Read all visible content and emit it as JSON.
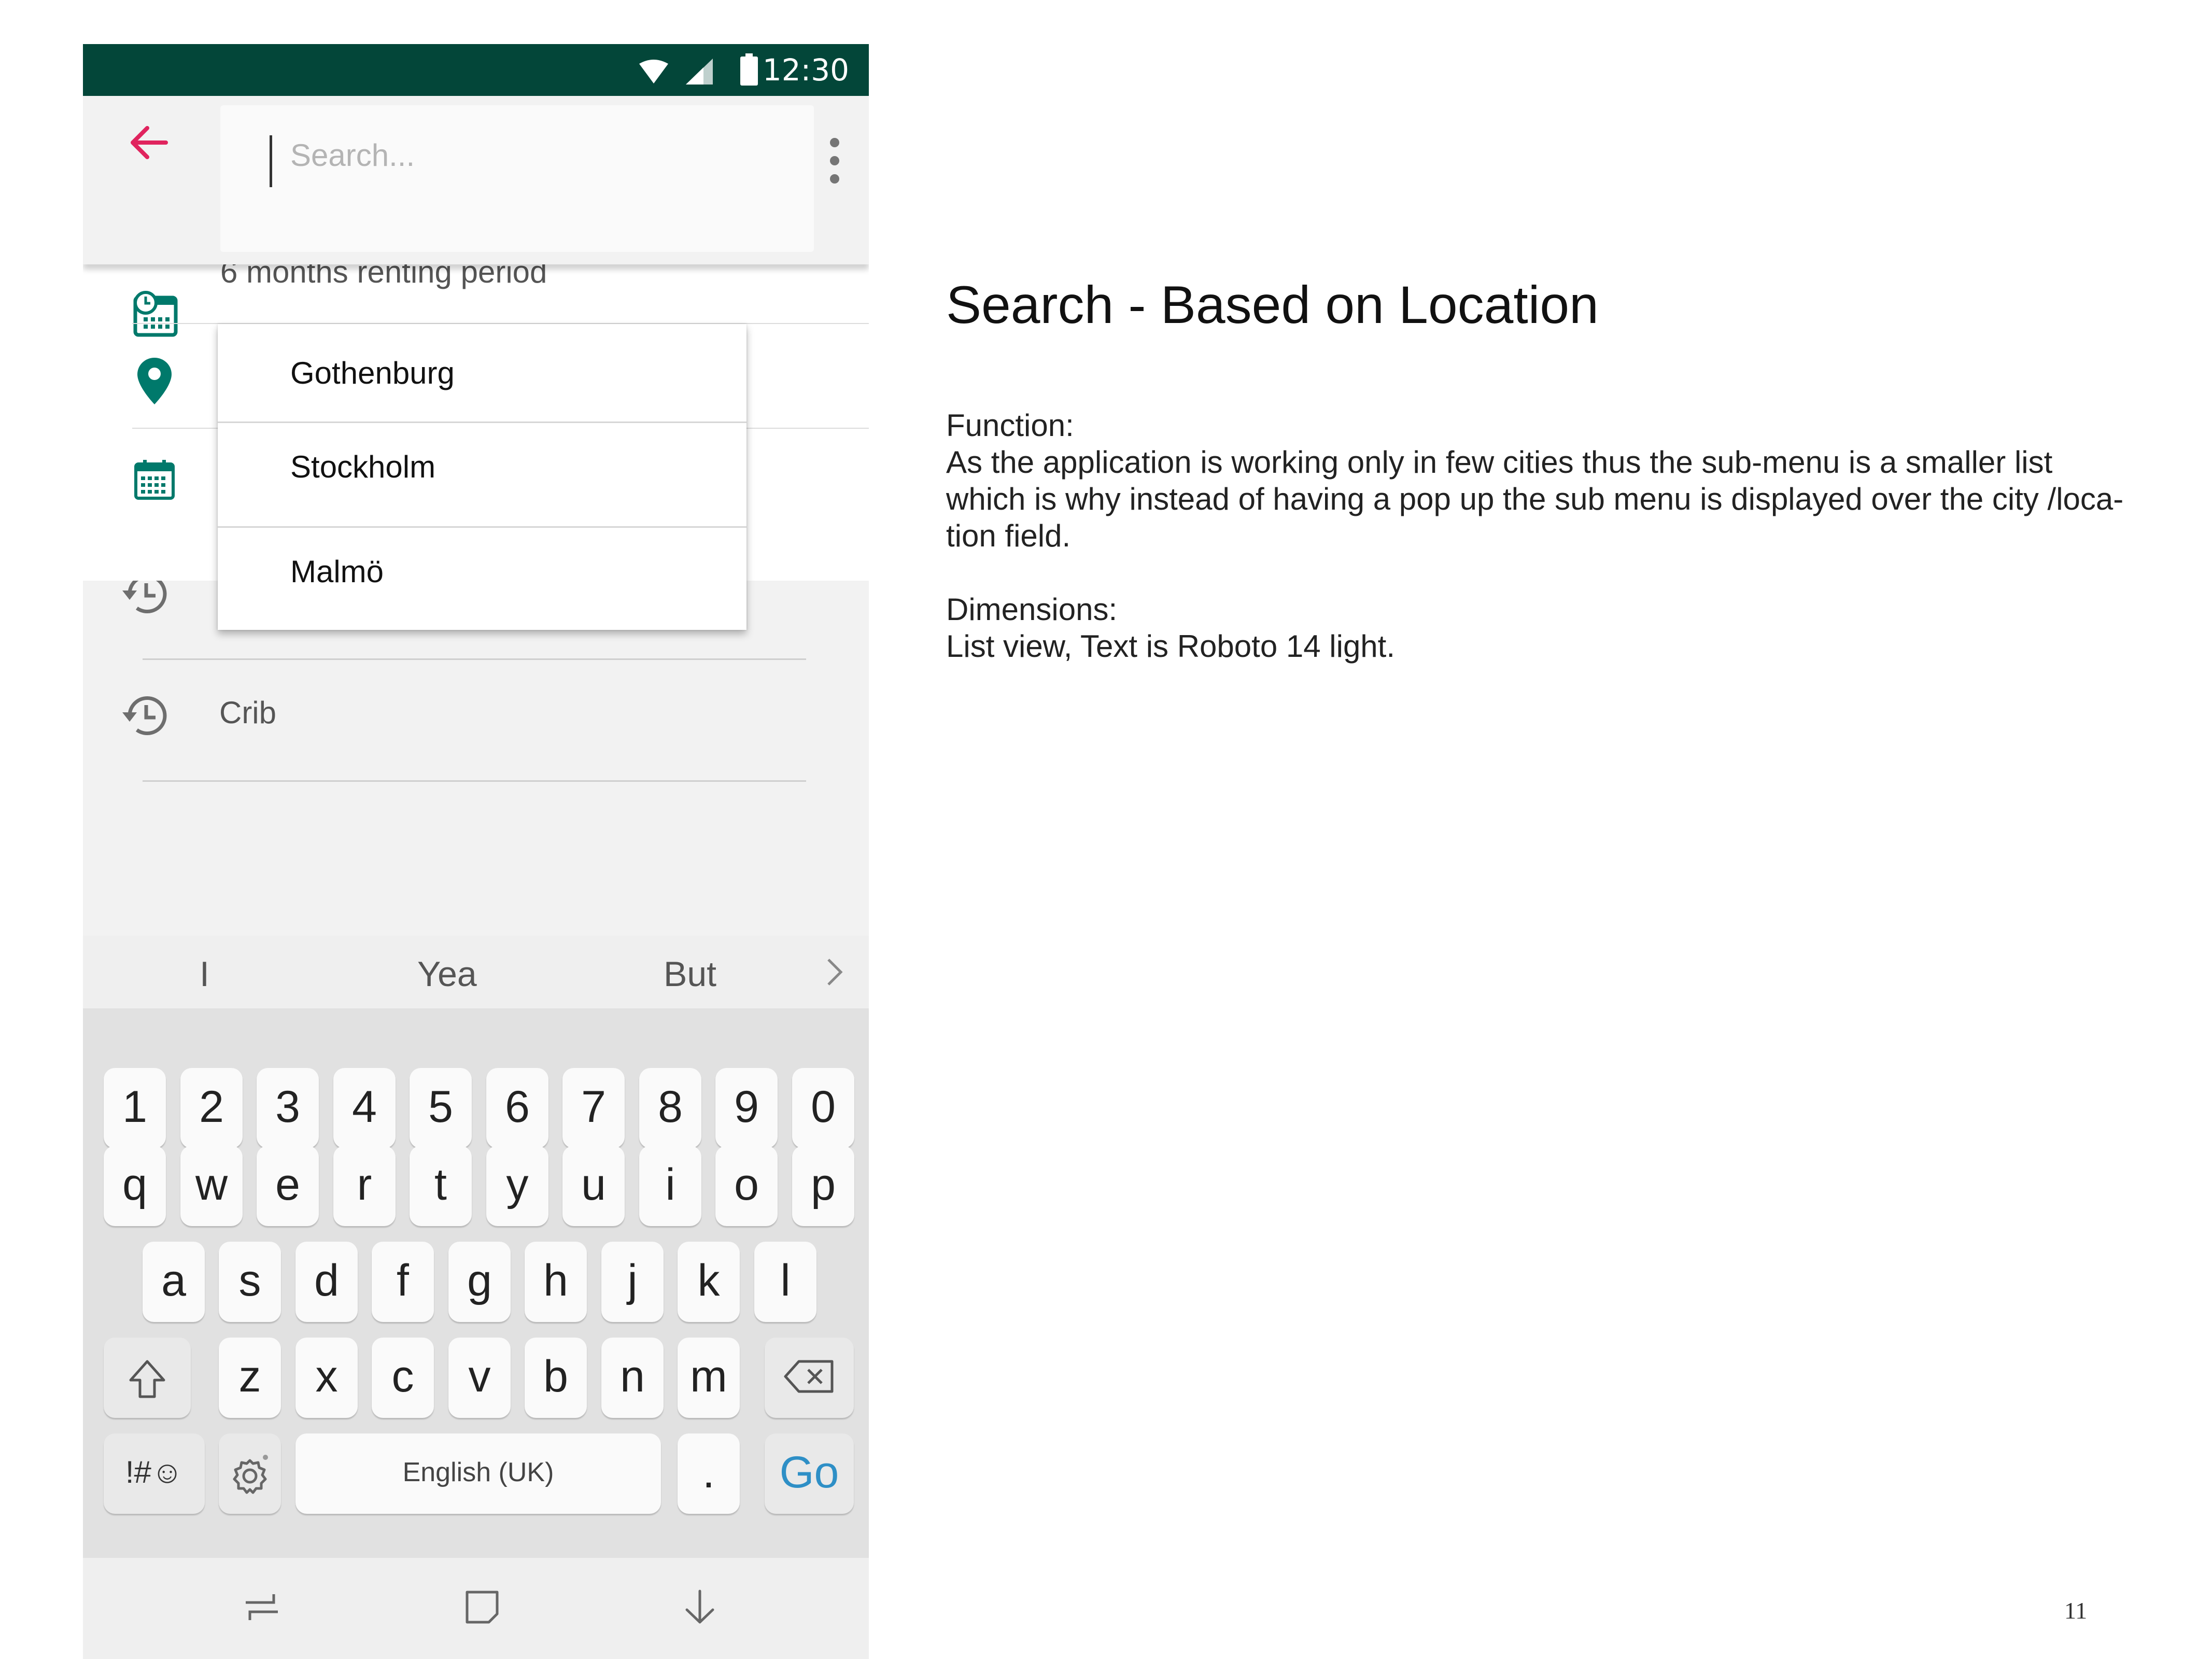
{
  "status_bar": {
    "time": "12:30"
  },
  "search": {
    "placeholder": "Search..."
  },
  "filters": {
    "renting_period": "6 months renting period"
  },
  "city_dropdown": {
    "options": [
      "Gothenburg",
      "Stockholm",
      "Malmö"
    ]
  },
  "history": {
    "items": [
      "Crib"
    ]
  },
  "keyboard": {
    "suggestions": [
      "I",
      "Yea",
      "But"
    ],
    "number_row": [
      "1",
      "2",
      "3",
      "4",
      "5",
      "6",
      "7",
      "8",
      "9",
      "0"
    ],
    "row1": [
      "q",
      "w",
      "e",
      "r",
      "t",
      "y",
      "u",
      "i",
      "o",
      "p"
    ],
    "row2": [
      "a",
      "s",
      "d",
      "f",
      "g",
      "h",
      "j",
      "k",
      "l"
    ],
    "row3": [
      "z",
      "x",
      "c",
      "v",
      "b",
      "n",
      "m"
    ],
    "symbols_label": "!#☺",
    "space_label": "English (UK)",
    "period_label": ".",
    "go_label": "Go"
  },
  "description": {
    "title": "Search - Based on Location",
    "function_heading": "Function:",
    "function_lines": [
      "As the application is working only in few cities thus the sub-menu is a smaller list",
      "which is why instead of having a pop up the sub menu is displayed over the city /loca-",
      "tion field."
    ],
    "dimensions_heading": "Dimensions:",
    "dimensions_text": "List view, Text is Roboto 14 light."
  },
  "page_number": "11",
  "colors": {
    "status_bar": "#034639",
    "accent": "#e0245e",
    "icon_teal": "#00796b",
    "go_blue": "#2e8fc6"
  }
}
